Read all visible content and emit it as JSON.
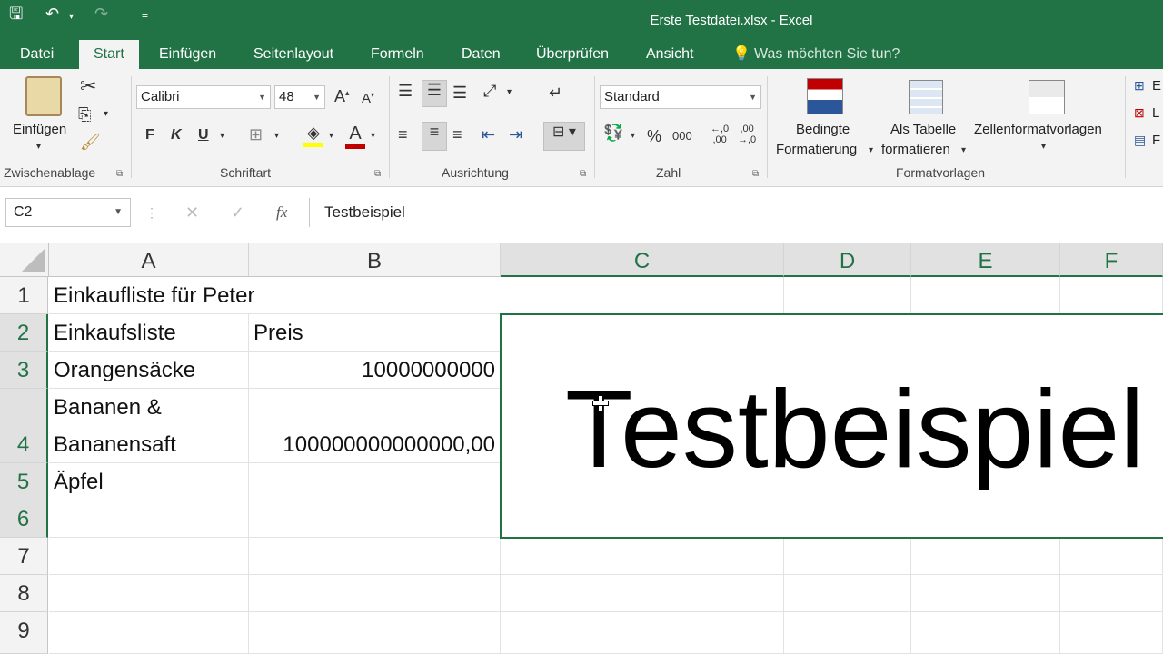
{
  "window": {
    "title": "Erste Testdatei.xlsx - Excel"
  },
  "qat": {
    "save": "🖫",
    "undo": "↶",
    "redo": "↷",
    "customize": "="
  },
  "tabs": [
    "Datei",
    "Start",
    "Einfügen",
    "Seitenlayout",
    "Formeln",
    "Daten",
    "Überprüfen",
    "Ansicht"
  ],
  "tellme": "Was möchten Sie tun?",
  "ribbon": {
    "clipboard": {
      "paste_label": "Einfügen",
      "group": "Zwischenablage"
    },
    "font": {
      "name": "Calibri",
      "size": "48",
      "bold": "F",
      "italic": "K",
      "underline": "U",
      "group": "Schriftart"
    },
    "alignment": {
      "group": "Ausrichtung"
    },
    "number": {
      "format": "Standard",
      "percent": "%",
      "thousands": "000",
      "group": "Zahl",
      "dec_inc": "←,0\n,00",
      "dec_dec": ",00\n→,0"
    },
    "styles": {
      "conditional_1": "Bedingte",
      "conditional_2": "Formatierung",
      "table_1": "Als Tabelle",
      "table_2": "formatieren",
      "cellstyles": "Zellenformatvorlagen",
      "group": "Formatvorlagen"
    },
    "cells": {
      "insert": "E",
      "delete": "L",
      "format": "F"
    }
  },
  "formula_bar": {
    "name_box": "C2",
    "fx": "fx",
    "cancel": "✕",
    "enter": "✓",
    "content": "Testbeispiel"
  },
  "columns": [
    "A",
    "B",
    "C",
    "D",
    "E",
    "F"
  ],
  "rows": [
    "1",
    "2",
    "3",
    "4",
    "5",
    "6",
    "7",
    "8",
    "9"
  ],
  "cells": {
    "A1": "Einkaufliste für Peter",
    "A2": "Einkaufsliste",
    "B2": "Preis",
    "A3": "Orangensäcke",
    "B3": "10000000000",
    "A4_1": "Bananen &",
    "A4_2": "Bananensaft",
    "B4": "100000000000000,00",
    "A5": "Äpfel",
    "C2": "Testbeispiel"
  },
  "colors": {
    "accent": "#217346",
    "ribbon_bg": "#f3f3f3"
  }
}
